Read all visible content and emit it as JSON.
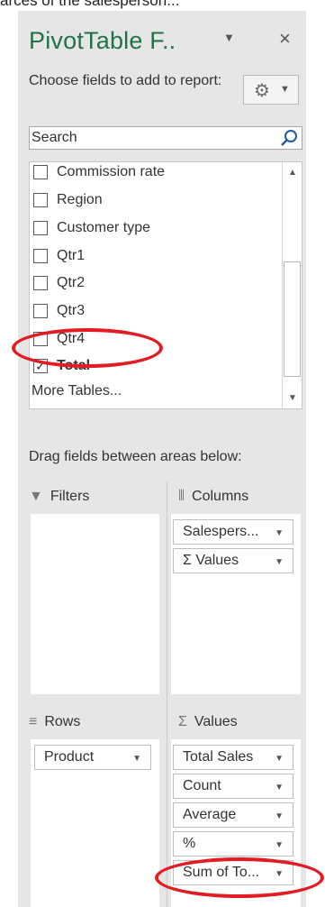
{
  "top_fragment": "arces of the salesperson...",
  "pane": {
    "title": "PivotTable F..",
    "title_dropdown_glyph": "▼",
    "close_glyph": "×",
    "choose_text": "Choose fields to add to report:",
    "tools_icon": "gear-icon",
    "tools_dropdown_glyph": "▼",
    "search_placeholder": "Search",
    "fields": [
      {
        "label": "Commission rate",
        "checked": false
      },
      {
        "label": "Region",
        "checked": false
      },
      {
        "label": "Customer type",
        "checked": false
      },
      {
        "label": "Qtr1",
        "checked": false
      },
      {
        "label": "Qtr2",
        "checked": false
      },
      {
        "label": "Qtr3",
        "checked": false
      },
      {
        "label": "Qtr4",
        "checked": false
      },
      {
        "label": "Total",
        "checked": true
      }
    ],
    "more_tables": "More Tables...",
    "drag_text": "Drag fields between areas below:",
    "areas": {
      "filters": {
        "label": "Filters",
        "icon": "filter-icon",
        "items": []
      },
      "columns": {
        "label": "Columns",
        "icon": "columns-icon",
        "items": [
          "Salespers...",
          "Σ Values"
        ]
      },
      "rows": {
        "label": "Rows",
        "icon": "rows-icon",
        "items": [
          "Product"
        ]
      },
      "values": {
        "label": "Values",
        "icon": "sigma-icon",
        "items": [
          "Total Sales",
          "Count",
          "Average",
          "%",
          "Sum of To..."
        ]
      }
    },
    "highlight_color": "#e31b23",
    "accent_color": "#217346"
  }
}
